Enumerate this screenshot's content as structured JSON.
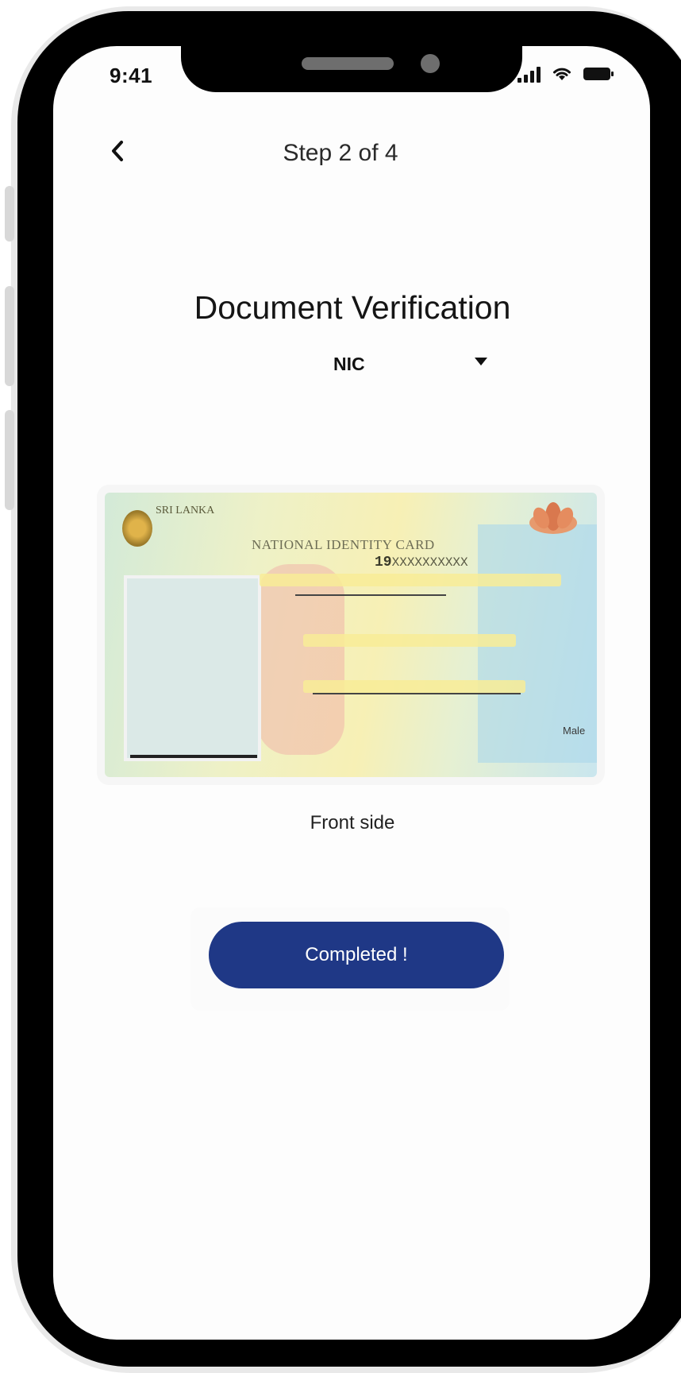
{
  "status_bar": {
    "time": "9:41"
  },
  "header": {
    "step": "Step 2 of 4"
  },
  "main": {
    "title": "Document Verification",
    "document_type": "NIC",
    "caption": "Front side",
    "complete_label": "Completed !"
  },
  "card": {
    "country_small": "SRI LANKA",
    "title": "NATIONAL IDENTITY CARD",
    "number_prefix": "19",
    "number_masked": "XXXXXXXXXX",
    "sex_value": "Male"
  },
  "colors": {
    "primary": "#1f3886"
  }
}
